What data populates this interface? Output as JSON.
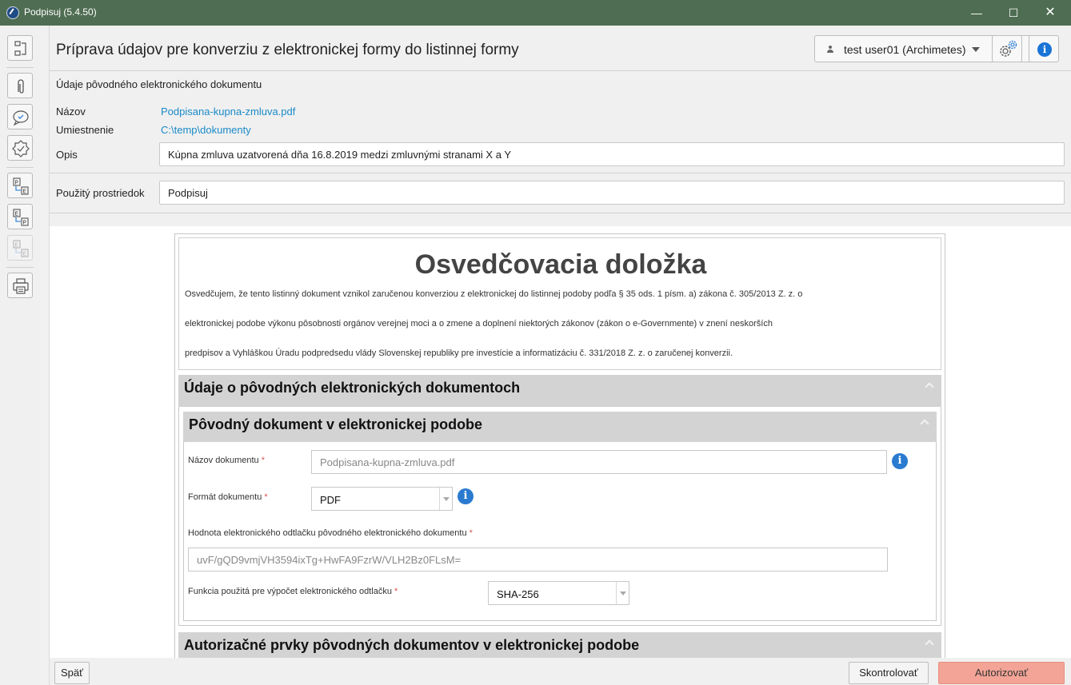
{
  "window": {
    "title": "Podpisuj (5.4.50)",
    "minimize": "—",
    "maximize": "☐",
    "close": "✕"
  },
  "header": {
    "title": "Príprava údajov pre konverziu z elektronickej formy do listinnej formy",
    "user": "test user01 (Archimetes)",
    "info_glyph": "i"
  },
  "original_doc": {
    "section_title": "Údaje pôvodného elektronického dokumentu",
    "name_label": "Názov",
    "name_value": "Podpisana-kupna-zmluva.pdf",
    "location_label": "Umiestnenie",
    "location_value": "C:\\temp\\dokumenty",
    "description_label": "Opis",
    "description_value": "Kúpna zmluva uzatvorená dňa 16.8.2019 medzi zmluvnými stranami X a Y",
    "tool_label": "Použitý prostriedok",
    "tool_value": "Podpisuj"
  },
  "document": {
    "title": "Osvedčovacia doložka",
    "line1": "Osvedčujem, že tento listinný dokument vznikol zaručenou konverziou z elektronickej do listinnej podoby podľa § 35 ods. 1 písm. a) zákona č. 305/2013 Z. z. o",
    "line2": "elektronickej podobe výkonu pôsobnosti orgánov verejnej moci a o zmene a doplnení niektorých zákonov (zákon o e-Governmente) v znení neskorších",
    "line3": "predpisov a Vyhláškou Úradu podpredsedu vlády Slovenskej republiky pre investície a informatizáciu č. 331/2018 Z. z. o zaručenej konverzii.",
    "panel_outer_title": "Údaje o pôvodných elektronických dokumentoch",
    "panel_inner_title": "Pôvodný dokument v elektronickej podobe",
    "doc_name_label": "Názov dokumentu",
    "doc_name_value": "Podpisana-kupna-zmluva.pdf",
    "format_label": "Formát dokumentu",
    "format_value": "PDF",
    "hash_label": "Hodnota elektronického odtlačku pôvodného elektronického dokumentu",
    "hash_value": "uvF/gQD9vmjVH3594ixTg+HwFA9FzrW/VLH2Bz0FLsM=",
    "hash_fn_label": "Funkcia použitá pre výpočet elektronického odtlačku",
    "hash_fn_value": "SHA-256",
    "required_mark": "*",
    "info_glyph": "i",
    "panel_auth_title": "Autorizačné prvky pôvodných dokumentov v elektronickej podobe"
  },
  "footer": {
    "back": "Späť",
    "check": "Skontrolovať",
    "authorize": "Autorizovať"
  },
  "colors": {
    "titlebar": "#4f6d52",
    "link": "#1a8ac8",
    "authorize_button": "#f3a496",
    "panel_header": "#d3d3d3",
    "info_icon": "#2a7bd0"
  }
}
